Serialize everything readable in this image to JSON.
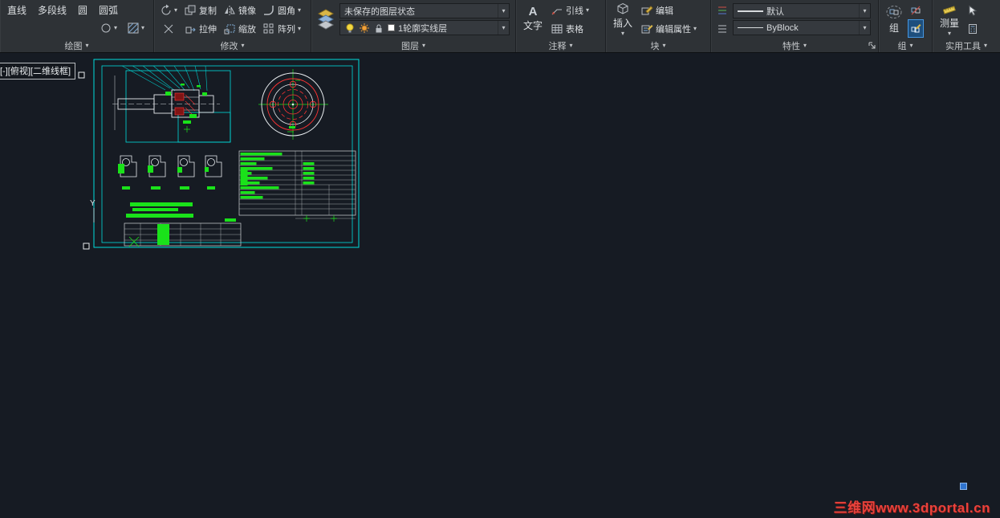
{
  "ribbon": {
    "draw": {
      "title": "绘图",
      "line": "直线",
      "pline": "多段线",
      "circle": "圆",
      "arc": "圆弧"
    },
    "modify": {
      "title": "修改",
      "copy": "复制",
      "mirror": "镜像",
      "fillet": "圆角",
      "stretch": "拉伸",
      "scale": "缩放",
      "array": "阵列"
    },
    "layers": {
      "title": "图层",
      "state": "未保存的图层状态",
      "current": "1轮廓实线层"
    },
    "annotate": {
      "title": "注释",
      "text": "文字",
      "leader": "引线",
      "table": "表格"
    },
    "block": {
      "title": "块",
      "insert": "插入",
      "edit": "编辑",
      "edit_attr": "编辑属性"
    },
    "properties": {
      "title": "特性",
      "lineweight": "默认",
      "linetype": "ByBlock"
    },
    "group": {
      "title": "组",
      "group": "组"
    },
    "utilities": {
      "title": "实用工具",
      "measure": "测量"
    }
  },
  "viewport": {
    "label": "[-][俯视][二维线框]"
  },
  "drawing": {
    "ucs_y": "Y"
  },
  "watermark": {
    "text": "三维网www.3dportal.cn"
  }
}
